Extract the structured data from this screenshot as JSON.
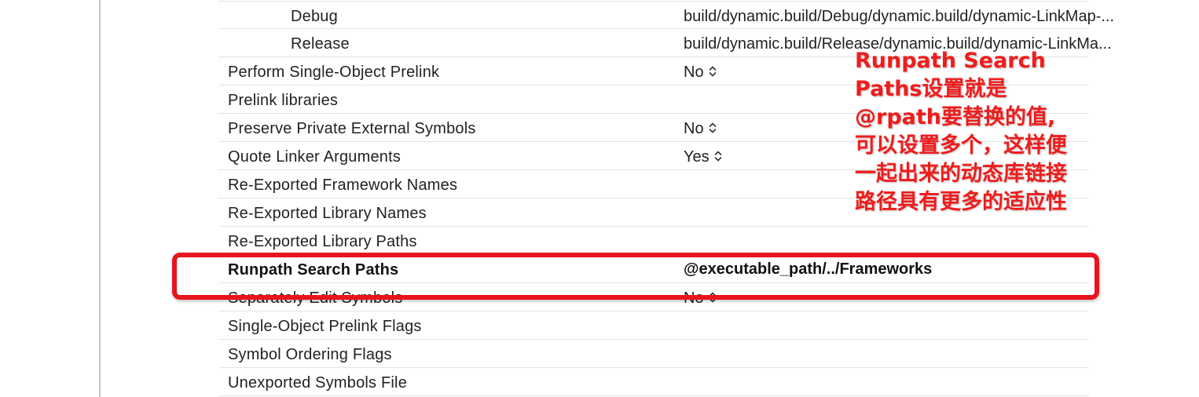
{
  "rows": [
    {
      "label": "Debug",
      "value": "build/dynamic.build/Debug/dynamic.build/dynamic-LinkMap-..."
    },
    {
      "label": "Release",
      "value": "build/dynamic.build/Release/dynamic.build/dynamic-LinkMa..."
    },
    {
      "label": "Perform Single-Object Prelink",
      "value": "No"
    },
    {
      "label": "Prelink libraries",
      "value": ""
    },
    {
      "label": "Preserve Private External Symbols",
      "value": "No"
    },
    {
      "label": "Quote Linker Arguments",
      "value": "Yes"
    },
    {
      "label": "Re-Exported Framework Names",
      "value": ""
    },
    {
      "label": "Re-Exported Library Names",
      "value": ""
    },
    {
      "label": "Re-Exported Library Paths",
      "value": ""
    },
    {
      "label": "Runpath Search Paths",
      "value": "@executable_path/../Frameworks"
    },
    {
      "label": "Separately Edit Symbols",
      "value": "No"
    },
    {
      "label": "Single-Object Prelink Flags",
      "value": ""
    },
    {
      "label": "Symbol Ordering Flags",
      "value": ""
    },
    {
      "label": "Unexported Symbols File",
      "value": ""
    }
  ],
  "annotation": {
    "lines": [
      "Runpath Search",
      "Paths设置就是",
      "@rpath要替换的值,",
      "可以设置多个，这样便",
      "一起出来的动态库链接",
      "路径具有更多的适应性"
    ]
  },
  "colors": {
    "highlight": "#e8141e",
    "annotation_text": "#f01c1c",
    "row_separator": "#e4e4e4"
  },
  "icons": {
    "stepper": "up-down-chevron-icon"
  }
}
